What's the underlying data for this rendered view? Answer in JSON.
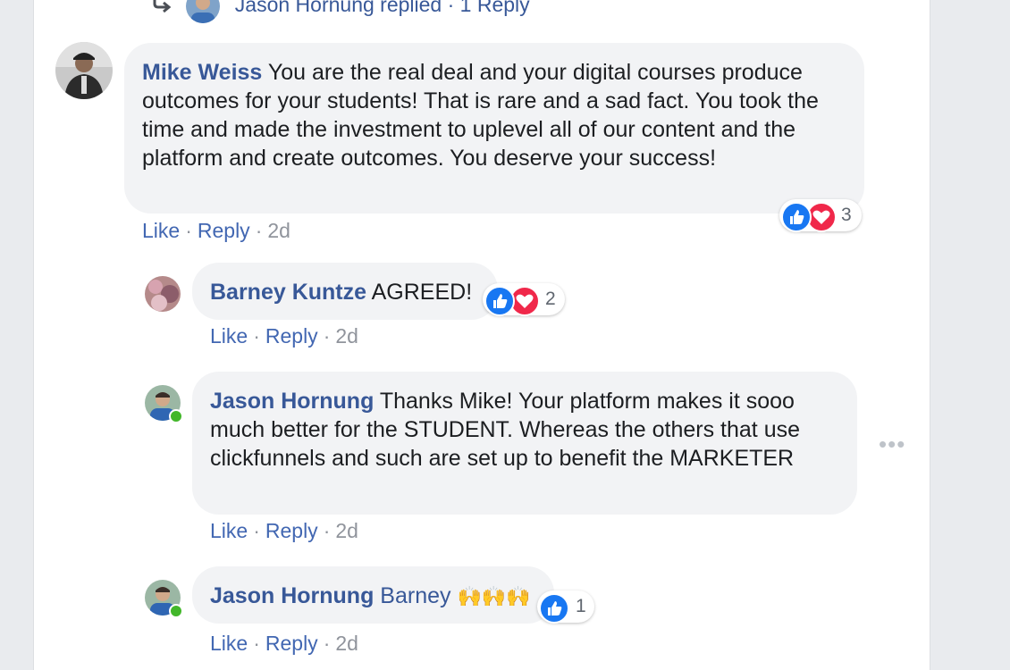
{
  "replied_row": {
    "text": "Jason Hornung replied · 1 Reply"
  },
  "comments": [
    {
      "author": "Mike Weiss",
      "text": "You are the real deal and your digital courses produce outcomes for your students! That is rare and a sad fact. You took the time and made the investment to uplevel all of our content and the platform and create outcomes. You deserve your success!",
      "like_label": "Like",
      "reply_label": "Reply",
      "time": "2d",
      "reaction_count": "3",
      "reactions": [
        "like-icon",
        "love-icon"
      ]
    },
    {
      "author": "Barney Kuntze",
      "text": "AGREED!",
      "like_label": "Like",
      "reply_label": "Reply",
      "time": "2d",
      "reaction_count": "2",
      "reactions": [
        "like-icon",
        "love-icon"
      ]
    },
    {
      "author": "Jason Hornung",
      "text": "Thanks Mike! Your platform makes it sooo much better for the STUDENT. Whereas the others that use clickfunnels and such are set up to benefit the MARKETER",
      "like_label": "Like",
      "reply_label": "Reply",
      "time": "2d",
      "online": true
    },
    {
      "author": "Jason Hornung",
      "text": "Barney",
      "emoji": "🙌🙌🙌",
      "like_label": "Like",
      "reply_label": "Reply",
      "time": "2d",
      "reaction_count": "1",
      "reactions": [
        "like-icon"
      ],
      "online": true
    }
  ],
  "more_options_icon": "more-horizontal-icon",
  "colors": {
    "author_link": "#385898",
    "action_link": "#4267b2",
    "bubble": "#f2f3f5",
    "like": "#1877f2",
    "love": "#f0284a",
    "online": "#42b72a"
  }
}
